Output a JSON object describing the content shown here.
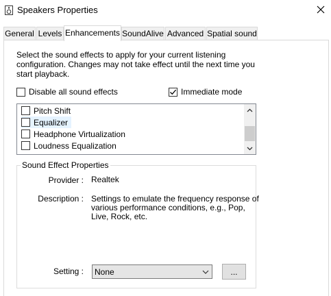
{
  "window": {
    "title": "Speakers Properties",
    "close_icon": "close-icon"
  },
  "tabs": [
    {
      "label": "General"
    },
    {
      "label": "Levels"
    },
    {
      "label": "Enhancements",
      "active": true
    },
    {
      "label": "SoundAlive"
    },
    {
      "label": "Advanced"
    },
    {
      "label": "Spatial sound"
    }
  ],
  "enhancements": {
    "description": "Select the sound effects to apply for your current listening configuration. Changes may not take effect until the next time you start playback.",
    "disable_all": {
      "label": "Disable all sound effects",
      "checked": false
    },
    "immediate_mode": {
      "label": "Immediate mode",
      "checked": true
    },
    "effects": [
      {
        "label": "Pitch Shift",
        "checked": false
      },
      {
        "label": "Equalizer",
        "checked": false
      },
      {
        "label": "Headphone Virtualization",
        "checked": false
      },
      {
        "label": "Loudness Equalization",
        "checked": false
      }
    ]
  },
  "properties": {
    "group_title": "Sound Effect Properties",
    "provider_label": "Provider :",
    "provider_value": "Realtek",
    "description_label": "Description :",
    "description_lines": [
      "Settings to emulate the frequency response of",
      "various performance conditions,  e.g., Pop,",
      "Live, Rock, etc."
    ],
    "setting_label": "Setting :",
    "setting_value": "None",
    "more_button": "..."
  },
  "colors": {
    "border": "#d9d9d9",
    "hover": "#e5f3ff",
    "scroll_thumb": "#cdcdcd"
  }
}
